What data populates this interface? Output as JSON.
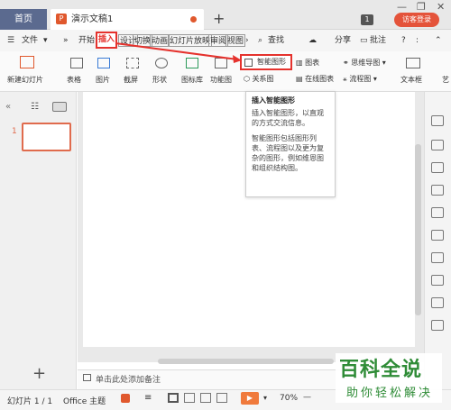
{
  "titlebar": {
    "home_tab": "首页",
    "doc_tab": "演示文稿1",
    "doc_icon": "P",
    "new_tab": "+",
    "badge_count": "1",
    "visitor_login": "访客登录",
    "min": "—",
    "restore": "❐",
    "close": "✕"
  },
  "menubar": {
    "file": "文件",
    "start": "开始",
    "insert": "插入",
    "design": "设计",
    "transition": "切换",
    "animation": "动画",
    "slideshow": "幻灯片放映",
    "review": "审阅",
    "view": "视图",
    "search": "查找",
    "share": "分享",
    "annotate": "批注",
    "help": "?"
  },
  "ribbon": {
    "new_slide": "新建幻灯片",
    "table": "表格",
    "picture": "图片",
    "screenshot": "截屏",
    "shape": "形状",
    "icon_lib": "图标库",
    "feature_chart": "功能图",
    "smart_art": "智能图形",
    "chart": "图表",
    "relation": "关系图",
    "online_chart": "在线图表",
    "mindmap": "思维导图",
    "flowchart": "流程图",
    "textbox": "文本框",
    "art": "艺"
  },
  "tooltip": {
    "title": "插入智能图形",
    "line1": "插入智能图形，以直观的方式交流信息。",
    "line2": "智能图形包括图形列表、流程图以及更为复杂的图形，例如维恩图和组织结构图。"
  },
  "left_panel": {
    "slide_number": "1",
    "add": "+"
  },
  "notes": {
    "placeholder": "单击此处添加备注"
  },
  "statusbar": {
    "slide_info": "幻灯片 1 / 1",
    "theme": "Office 主题",
    "zoom": "70%",
    "zoom_minus": "—",
    "zoom_plus": "+"
  },
  "watermark": {
    "big": "百科全说",
    "small": "助你轻松解决"
  },
  "colors": {
    "accent_red": "#e5322d",
    "brand_orange": "#e0582d",
    "watermark_green": "#2f8c37"
  }
}
